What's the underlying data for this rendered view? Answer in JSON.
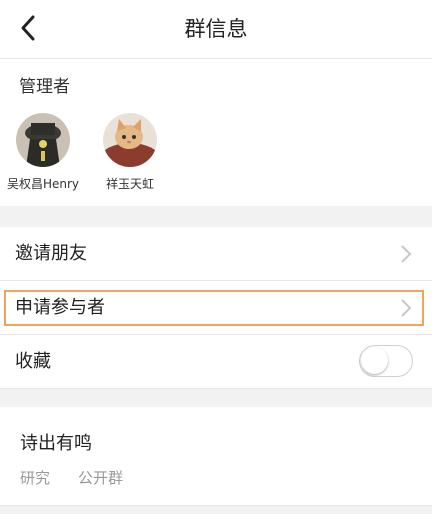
{
  "header": {
    "title": "群信息"
  },
  "admins": {
    "title": "管理者",
    "members": [
      {
        "name": "吴权昌Henry",
        "avatar": "avatar-dark-hat"
      },
      {
        "name": "祥玉天虹",
        "avatar": "avatar-kitten"
      }
    ]
  },
  "menu": {
    "invite_label": "邀请朋友",
    "apply_label": "申请参与者",
    "favorite_label": "收藏",
    "favorite_on": false
  },
  "group": {
    "name": "诗出有鸣",
    "tags": [
      "研究",
      "公开群"
    ]
  },
  "colors": {
    "highlight": "#f0a35a",
    "chevron": "#c8c8c8"
  }
}
